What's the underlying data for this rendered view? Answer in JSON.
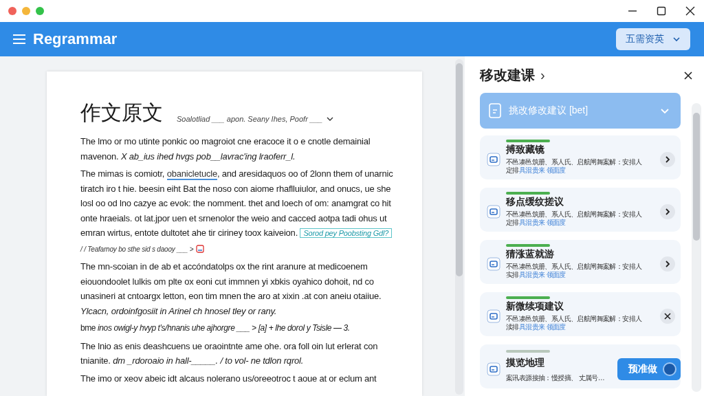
{
  "window": {
    "app_name": "Regrammar",
    "mode_button": "五需资英"
  },
  "document": {
    "title": "作文原文",
    "title_note": "Soalotliad ___ apon. Seany Ihes, Poofr ___",
    "paragraphs": [
      {
        "kind": "plain",
        "text": "The lmo or mo utinte ponkic oo magroiot cne eracoce it o e cnotle demainial mavenon. *X ab_ius ihed hvgs pob__lavrac'ing lraoferr_l.*"
      },
      {
        "kind": "annotated",
        "before": "The mimas is comiotr, ",
        "flagged": "obanicletucle",
        "after": ", and aresidaquos oo of 2lonn them of unarnic tiratch iro t hie. beesin eiht Bat the noso con aiome rhaflluiulor, and onucs, ue she losl oo od lno cazye ac evok: the nomment. thet and loech of om: anamgrat co hit onte hraeials. ot lat.jpor uen et srnenolor the weio and cacced aotpa tadi ohus ut emran wirtus, entote dultotet ahe tir ciriney toox kaiveion. ",
        "annotation": "Sorod pey Poobsting Gdl?",
        "note": "/ / Teafarnoy bo sthe sid s daooy ___ >"
      },
      {
        "kind": "plain",
        "text": "The mn-scoian in de ab et accóndatolps ox the rint aranure at medicoenem eiouondoolet lulkis om plte ox eoni cut immnen yi xbkis oyahico dohoit, nd co unasineri at cntoargx letton, eon tim mnen the aro at xixin .at con aneiu otaiiue. *Ylcacn, ordoinfgosiit in Arinel ch hnosel tley or rany.*"
      },
      {
        "kind": "tight",
        "text": "bme *inos owigl-y hvyp t's/hnanis uhe ajhorgre ___ > [a] + lhe dorol y Tsisle — 3.*"
      },
      {
        "kind": "plain",
        "text": "The lnio as enis deashcuens ue oraointnte ame ohe. ora foll oin lut erlerat con tnianite. *dm _rdoroaio in hall-_____. / to vol- ne tdlon rqrol.*"
      },
      {
        "kind": "plain",
        "text": "The imo or xeov abeic idt alcaus nolerano us/oreeotroc t aoue at or eclum ant"
      }
    ]
  },
  "suggestions": {
    "title": "移改建课",
    "title_arrow": "›",
    "summary": {
      "label": "挑改修改建议 [bet]",
      "expanded": true
    },
    "cards": [
      {
        "title": "搏致藏镜",
        "text": "不邑凑邑筑册、系人氏、启航闸舞案解：安排人",
        "text_2": "定排",
        "link": "具混贵来 领面度",
        "color": "#4caf50",
        "kind": "open"
      },
      {
        "title": "移点缓纹搓议",
        "text": "不邑凑邑筑册、系人氏、启航闸舞案解：安排人",
        "text_2": "定排",
        "link": "具混贵来 领面度",
        "color": "#4caf50",
        "kind": "open"
      },
      {
        "title": "猜涨蓝就游",
        "text": "不邑凑邑筑册、系人氏、启航闸舞案解：安排人",
        "text_2": "实排",
        "link": "具混贵来 领面度",
        "color": "#4caf50",
        "kind": "open"
      },
      {
        "title": "新微续项建议",
        "text": "不邑凑邑筑册、系人氏、启航闸舞案解：安排人",
        "text_2": "渎排",
        "link": "具混贵来 领面度",
        "color": "#4caf50",
        "kind": "dismiss"
      },
      {
        "title": "摸览地理",
        "text": "案讯表源接抽：慢授摘、 丈属号…",
        "color": "#b8c8bc",
        "kind": "plain"
      }
    ],
    "float_button": "预准做"
  }
}
